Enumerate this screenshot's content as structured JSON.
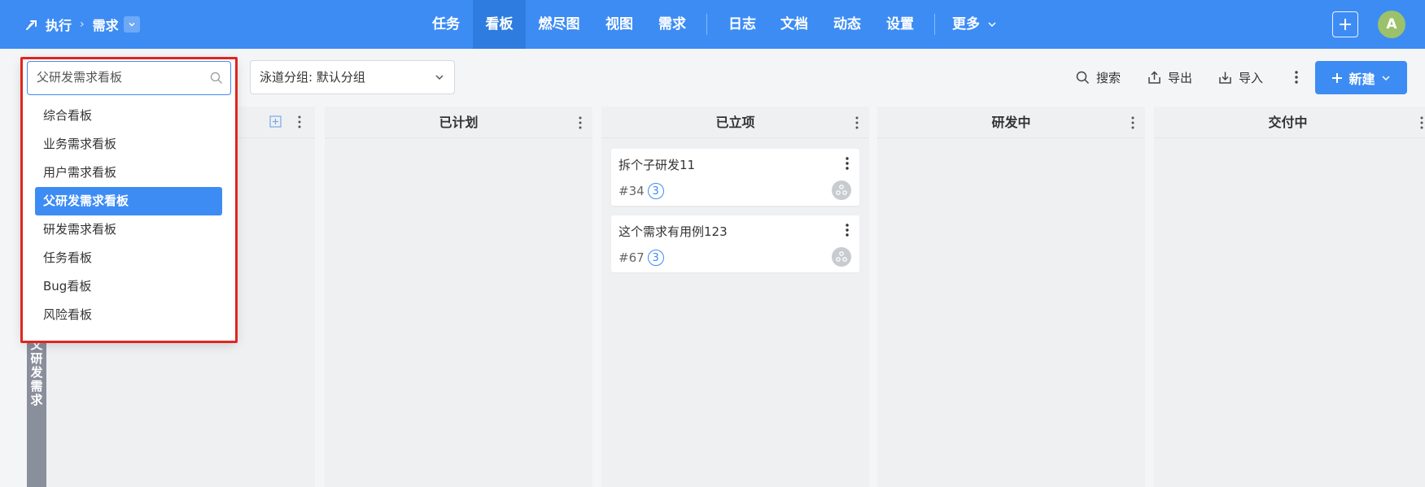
{
  "breadcrumb": {
    "root": "执行",
    "current": "需求"
  },
  "nav": {
    "tabs": [
      {
        "label": "任务"
      },
      {
        "label": "看板",
        "active": true
      },
      {
        "label": "燃尽图"
      },
      {
        "label": "视图"
      },
      {
        "label": "需求"
      },
      {
        "label": "日志"
      },
      {
        "label": "文档"
      },
      {
        "label": "动态"
      },
      {
        "label": "设置"
      },
      {
        "label": "更多"
      }
    ]
  },
  "user": {
    "avatar_letter": "A"
  },
  "toolbar": {
    "group_select": "泳道分组: 默认分组",
    "search": "搜索",
    "export": "导出",
    "import": "导入",
    "new": "新建"
  },
  "board_dropdown": {
    "search_value": "父研发需求看板",
    "items": [
      {
        "label": "综合看板"
      },
      {
        "label": "业务需求看板"
      },
      {
        "label": "用户需求看板"
      },
      {
        "label": "父研发需求看板",
        "selected": true
      },
      {
        "label": "研发需求看板"
      },
      {
        "label": "任务看板"
      },
      {
        "label": "Bug看板"
      },
      {
        "label": "风险看板"
      }
    ]
  },
  "columns": [
    {
      "title": ""
    },
    {
      "title": "已计划"
    },
    {
      "title": "已立项"
    },
    {
      "title": "研发中"
    },
    {
      "title": "交付中"
    }
  ],
  "cards": [
    {
      "title": "拆个子研发11",
      "id": "#34",
      "count": "3"
    },
    {
      "title": "这个需求有用例123",
      "id": "#67",
      "count": "3"
    }
  ],
  "lane": {
    "label": "父研发需求"
  },
  "colors": {
    "primary": "#3d8cf4",
    "highlight": "#e0261f",
    "lane": "#8a8f9c"
  }
}
